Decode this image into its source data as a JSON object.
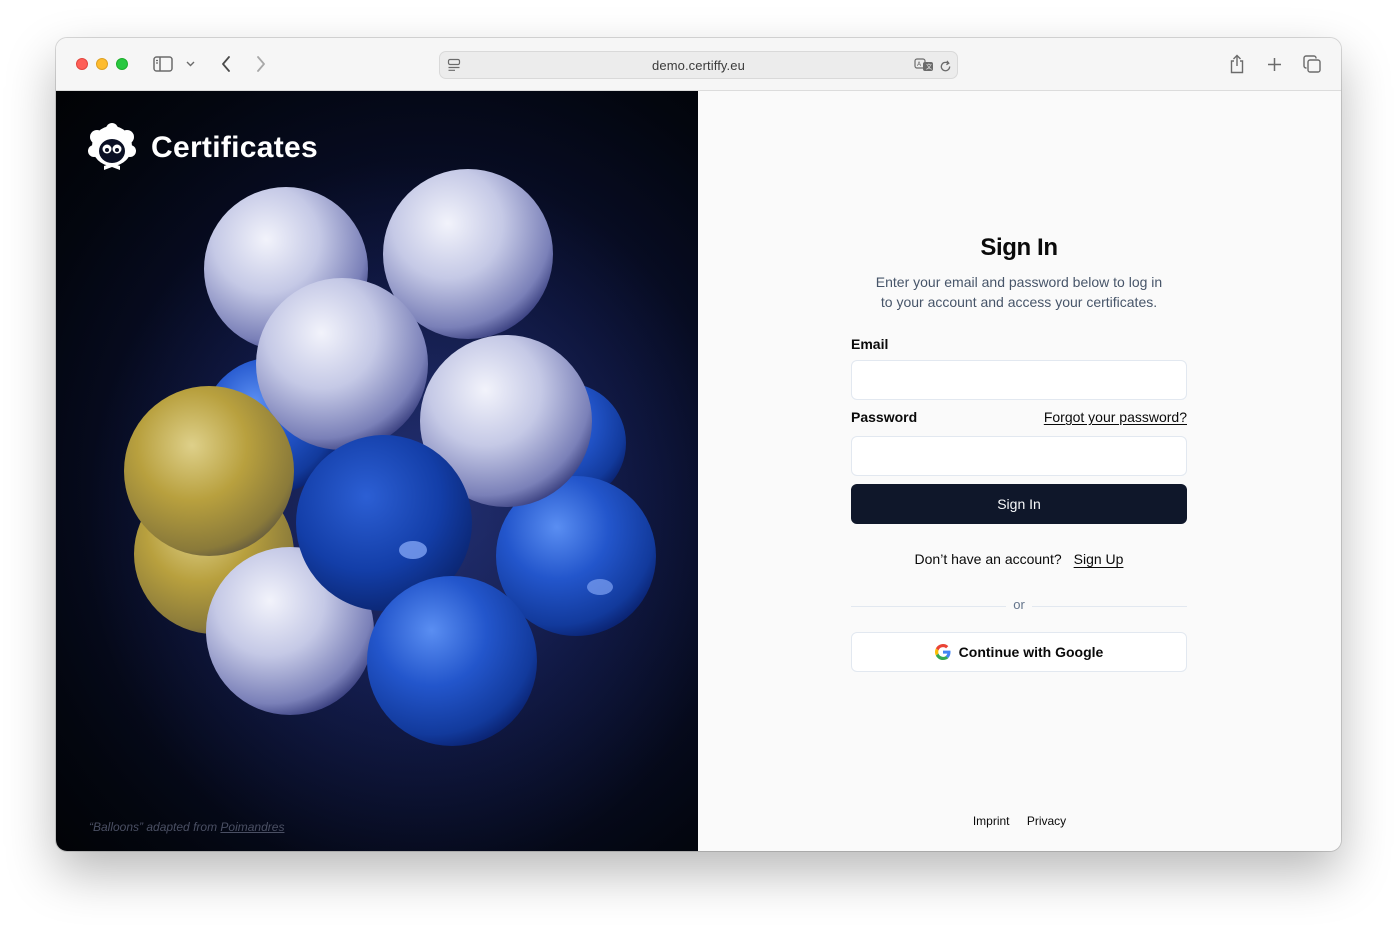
{
  "browser": {
    "url": "demo.certiffy.eu",
    "icons": [
      "sidebar-icon",
      "chevron-down-icon",
      "back-icon",
      "forward-icon",
      "page-menu-icon",
      "translate-icon",
      "reload-icon",
      "share-icon",
      "new-tab-icon",
      "tabs-overview-icon"
    ]
  },
  "brand": {
    "name": "Certificates"
  },
  "credit": {
    "prefix": "“Balloons” adapted from",
    "link": "Poimandres"
  },
  "signin": {
    "title": "Sign In",
    "subtitle_line1": "Enter your email and password below to log in",
    "subtitle_line2": "to your account and access your certificates.",
    "email_label": "Email",
    "email_value": "",
    "password_label": "Password",
    "password_value": "",
    "forgot_link": "Forgot your password?",
    "submit_label": "Sign In",
    "no_account_text": "Don’t have an account?",
    "signup_link": "Sign Up",
    "divider_text": "or",
    "google_label": "Continue with Google"
  },
  "footer": {
    "imprint": "Imprint",
    "privacy": "Privacy"
  },
  "colors": {
    "primary_button": "#0f172a",
    "left_background": "#03060f",
    "balloon_white": "#c9cde8",
    "balloon_blue": "#1e4fc4",
    "balloon_yellow": "#b89f3a"
  }
}
